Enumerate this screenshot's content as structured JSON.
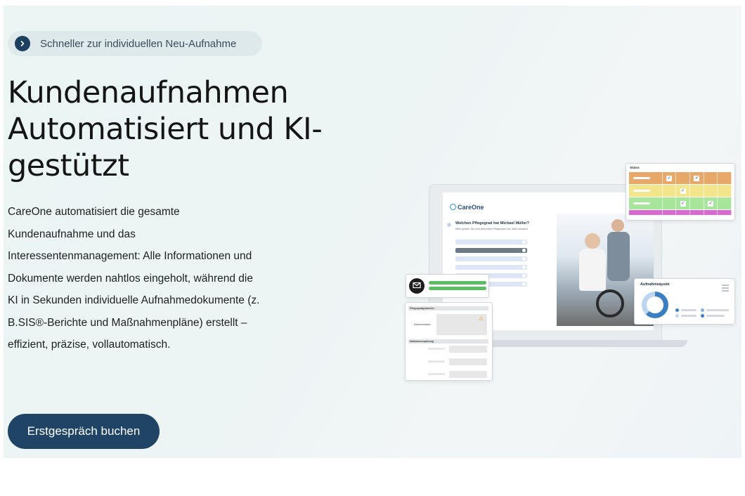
{
  "hero": {
    "pill_text": "Schneller zur individuellen Neu-Aufnahme",
    "headline": "Kundenaufnahmen Automatisiert und KI-gestützt",
    "description": "CareOne automatisiert die gesamte Kundenaufnahme und das Interessentenmanagement: Alle Informationen und Dokumente werden nahtlos eingeholt, während die KI in Sekunden individuelle Aufnahmedokumente (z. B.SIS®-Berichte und Maßnahmenpläne) erstellt – effizient, präzise, vollautomatisch.",
    "cta_label": "Erstgespräch buchen"
  },
  "illustration": {
    "logo_text": "CareOne",
    "question": "Welchen Pflegegrad hat Michael Müller?",
    "question_sub": "Bitte geben Sie den aktuellen Pflegegrad an, falls bekannt",
    "status_title": "Status",
    "quote_title": "Aufnahmequote",
    "doc_section_1": "Pflegegradgutachten",
    "doc_label_1": "Dokumentation",
    "doc_section_2": "Maßnahmenplanung",
    "colors": {
      "orange": "#e8a86a",
      "yellow": "#f2e58b",
      "green": "#a6e59a",
      "magenta": "#d76bd0",
      "donut_primary": "#3c7fc1",
      "donut_secondary": "#bcd6ef"
    }
  },
  "colors": {
    "cta_bg": "#1f4466",
    "pill_icon": "#1f3f61"
  }
}
